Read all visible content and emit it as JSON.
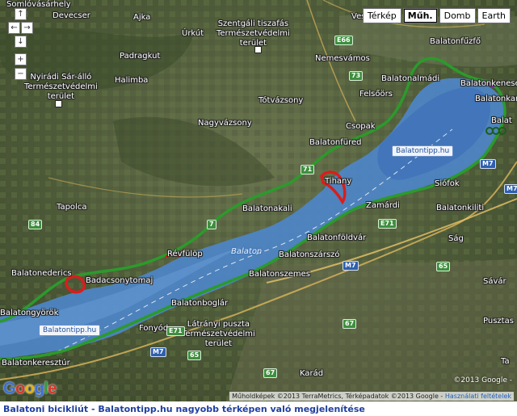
{
  "map": {
    "map_types": [
      {
        "label": "Térkép",
        "active": false
      },
      {
        "label": "Műh.",
        "active": true
      },
      {
        "label": "Domb",
        "active": false
      },
      {
        "label": "Earth",
        "active": false
      }
    ],
    "nav_controls": {
      "up": "↑",
      "left": "←",
      "right": "→",
      "down": "↓",
      "zoom_in": "+",
      "zoom_out": "−"
    },
    "places": [
      {
        "name": "Somlóvásárhely"
      },
      {
        "name": "Devecser"
      },
      {
        "name": "Ajka"
      },
      {
        "name": "Úrkút"
      },
      {
        "name": "Padragkut"
      },
      {
        "name": "Halimba"
      },
      {
        "name": "Szentgáli tiszafás\nTermészetvédelmi\nterület"
      },
      {
        "name": "Nemesvámos"
      },
      {
        "name": "Veszp"
      },
      {
        "name": "Balatonfűzfő"
      },
      {
        "name": "Balatonalmádi"
      },
      {
        "name": "Balatonkenese"
      },
      {
        "name": "Felsőörs"
      },
      {
        "name": "Nyirádi Sár-álló\nTermészetvédelmi\nterület"
      },
      {
        "name": "Tótvázsony"
      },
      {
        "name": "Nagyvázsony"
      },
      {
        "name": "Csopak"
      },
      {
        "name": "Balatonfüred"
      },
      {
        "name": "Balatonkara"
      },
      {
        "name": "Balat"
      },
      {
        "name": "Tihany"
      },
      {
        "name": "Siófok"
      },
      {
        "name": "Zamárdi"
      },
      {
        "name": "Balatonkiliti"
      },
      {
        "name": "Tapolca"
      },
      {
        "name": "Balatonakali"
      },
      {
        "name": "Révfülöp"
      },
      {
        "name": "Balatonföldvár"
      },
      {
        "name": "Ság"
      },
      {
        "name": "Sávár"
      },
      {
        "name": "Balatonszárszó"
      },
      {
        "name": "Balatonszemes"
      },
      {
        "name": "Balatonederics"
      },
      {
        "name": "Badacsonytomaj"
      },
      {
        "name": "Balatongyörök"
      },
      {
        "name": "Balatonboglár"
      },
      {
        "name": "Fonyód"
      },
      {
        "name": "Látrányi puszta\nTermészetvédelmi\nterület"
      },
      {
        "name": "Balatonkeresztúr"
      },
      {
        "name": "Karád"
      },
      {
        "name": "Pusztas"
      },
      {
        "name": "Ta"
      }
    ],
    "water_labels": [
      {
        "name": "Balaton"
      }
    ],
    "road_shields": [
      {
        "label": "E66",
        "color": "green"
      },
      {
        "label": "73",
        "color": "green"
      },
      {
        "label": "71",
        "color": "green"
      },
      {
        "label": "7",
        "color": "green"
      },
      {
        "label": "84",
        "color": "green"
      },
      {
        "label": "65",
        "color": "green"
      },
      {
        "label": "67",
        "color": "green"
      },
      {
        "label": "E71",
        "color": "green"
      },
      {
        "label": "M7",
        "color": "blue"
      },
      {
        "label": "M7",
        "color": "blue"
      },
      {
        "label": "E71",
        "color": "green"
      },
      {
        "label": "M7",
        "color": "blue"
      },
      {
        "label": "65",
        "color": "green"
      },
      {
        "label": "67",
        "color": "green"
      },
      {
        "label": "M7",
        "color": "blue"
      }
    ],
    "watermarks": [
      {
        "label": "Balatontipp.hu"
      },
      {
        "label": "Balatontipp.hu"
      }
    ],
    "google_logo": [
      "G",
      "o",
      "o",
      "g",
      "l",
      "e"
    ],
    "copyright_scale": "©2013 Google -",
    "attribution": "Műholdképek ©2013 TerraMetrics, Térképadatok ©2013 Google -",
    "terms_link": "Használati feltételek",
    "colors": {
      "route": "#2c9a2c",
      "lake": "#4d86c8",
      "lake_deep": "#3d6fb8",
      "highlight": "#d81e1e",
      "marker": "#8a2fb0"
    }
  },
  "caption": "Balatoni bicikliút - Balatontipp.hu nagyobb térképen való megjelenítése"
}
